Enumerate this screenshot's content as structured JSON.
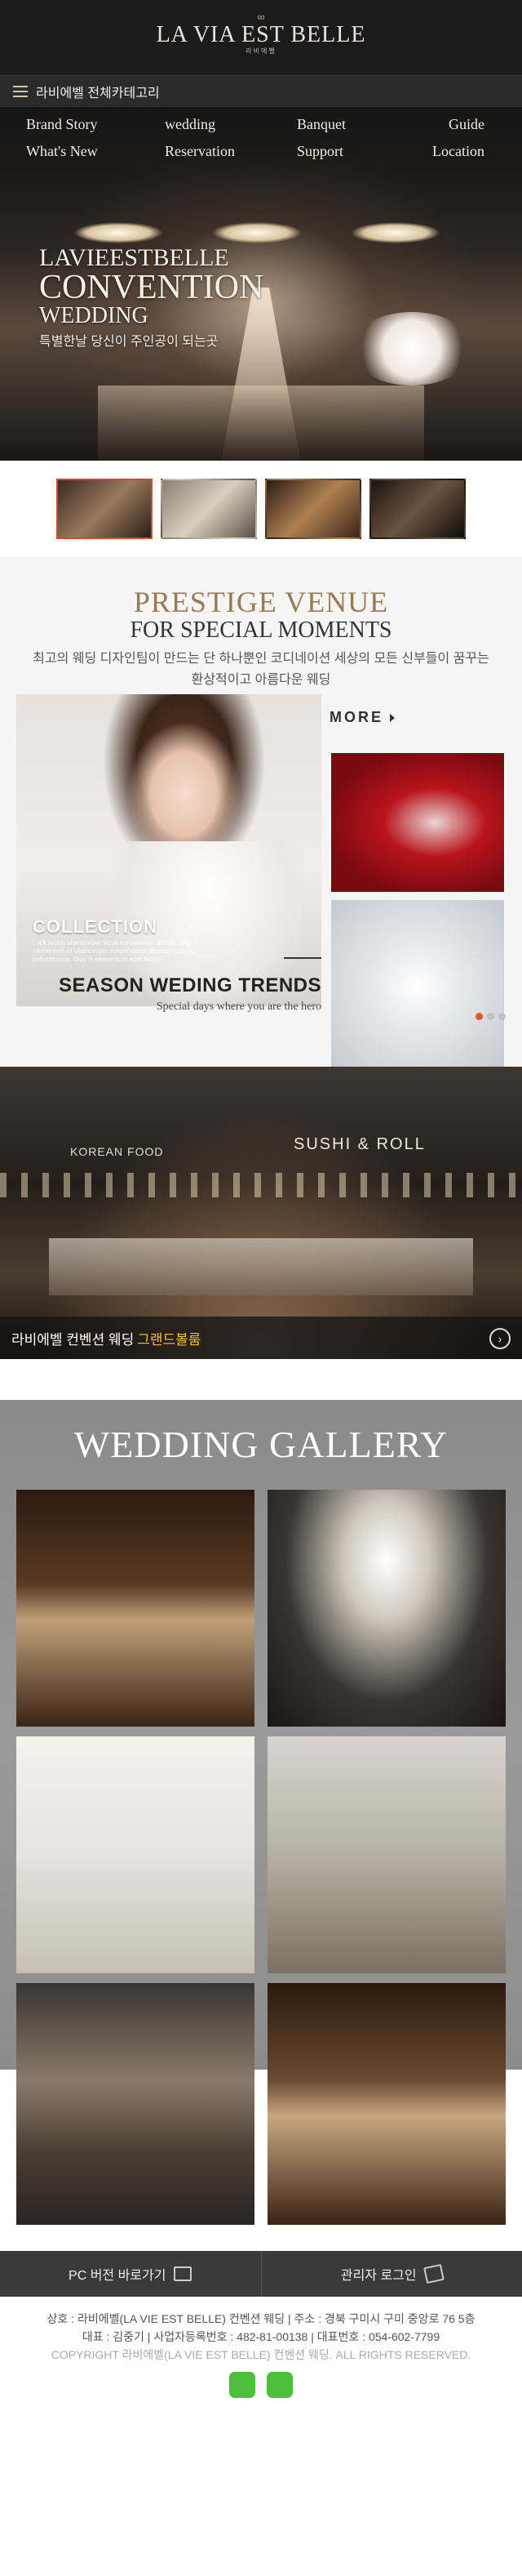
{
  "header": {
    "logo_mark": "∞",
    "logo_text": "LA VIA EST BELLE",
    "logo_sub": "라비에벨"
  },
  "category_bar": {
    "label": "라비에벨 전체카테고리"
  },
  "nav": [
    "Brand Story",
    "wedding",
    "Banquet",
    "Guide",
    "What's New",
    "Reservation",
    "Support",
    "Location"
  ],
  "hero": {
    "line1": "LAVIEESTBELLE",
    "line2": "CONVENTION",
    "line3": "WEDDING",
    "line4": "특별한날 당신이 주인공이 되는곳"
  },
  "prestige": {
    "title": "PRESTIGE VENUE",
    "subtitle": "FOR SPECIAL MOMENTS",
    "desc1": "최고의 웨딩 디자인팀이 만드는 단 하나뿐인 코디네이션 세상의 모든 신부들이 꿈꾸는",
    "desc2": "환상적이고 아름다운 웨딩",
    "more": "MORE",
    "collection": "COLLECTION",
    "collection_text": "Lock luctus ullamcorper lacus consectetur dictum congue elementum et ullamcorper suspendisse dignissim cursus pellentesque. Duis in elementum eget lectus.",
    "season_title": "SEASON WEDING TRENDS",
    "season_sub": "Special days where you are the hero"
  },
  "buffet": {
    "sign_left": "KOREAN FOOD",
    "sign_right": "SUSHI & ROLL",
    "caption": "라비에벨 컨벤션 웨딩",
    "caption_highlight": "그랜드볼룸"
  },
  "gallery": {
    "title": "WEDDING GALLERY"
  },
  "footer_buttons": {
    "pc": "PC 버전 바로가기",
    "admin": "관리자 로그인"
  },
  "footer": {
    "line1": "상호 : 라비에벨(LA VIE EST BELLE) 컨벤션 웨딩 | 주소 : 경북 구미시 구미 중앙로 76 5층",
    "line2": "대표 : 김중기 | 사업자등록번호 : 482-81-00138 | 대표번호 : 054-602-7799",
    "copyright": "COPYRIGHT 라비에벨(LA VIE EST BELLE) 컨벤션 웨딩. ALL RIGHTS RESERVED."
  },
  "colors": {
    "accent": "#9a7a52",
    "slider_active": "#e5572b",
    "caption_highlight": "#f2c230"
  }
}
